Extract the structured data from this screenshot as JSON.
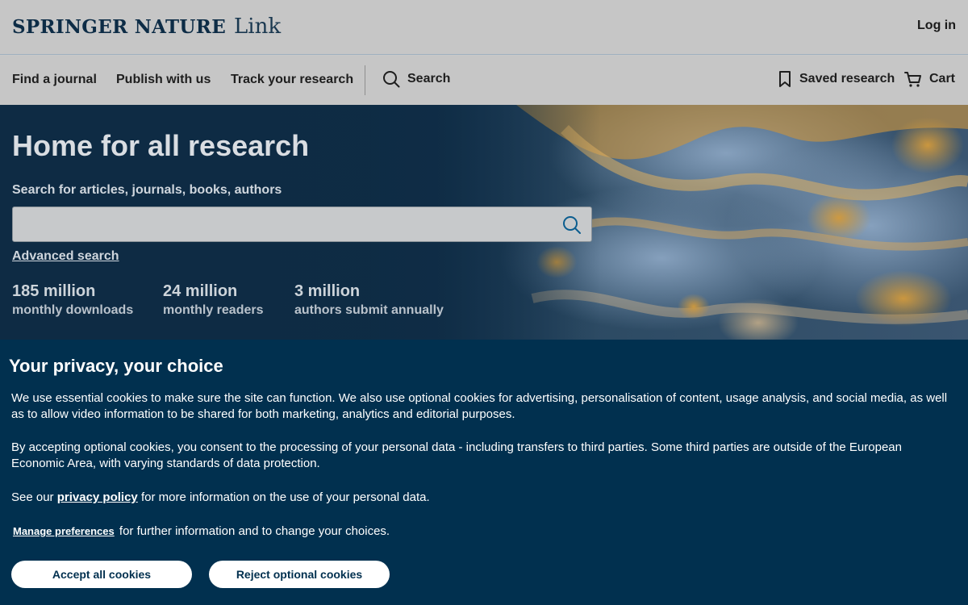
{
  "header": {
    "brand": "SPRINGER NATURE",
    "brand_sub": "Link",
    "login": "Log in"
  },
  "nav": {
    "items": [
      "Find a journal",
      "Publish with us",
      "Track your research"
    ],
    "search": "Search",
    "saved": "Saved research",
    "cart": "Cart"
  },
  "hero": {
    "title": "Home for all research",
    "search_label": "Search for articles, journals, books, authors",
    "search_value": "",
    "advanced": "Advanced search",
    "stats": [
      {
        "value": "185 million",
        "label": "monthly downloads"
      },
      {
        "value": "24 million",
        "label": "monthly readers"
      },
      {
        "value": "3 million",
        "label": "authors submit annually"
      }
    ]
  },
  "cookie": {
    "title": "Your privacy, your choice",
    "p1": "We use essential cookies to make sure the site can function. We also use optional cookies for advertising, personalisation of content, usage analysis, and social media, as well as to allow video information to be shared for both marketing, analytics and editorial purposes.",
    "p2": "By accepting optional cookies, you consent to the processing of your personal data - including transfers to third parties. Some third parties are outside of the European Economic Area, with varying standards of data protection.",
    "p3_pre": "See our",
    "privacy_link": "privacy policy",
    "p3_post": "for more information on the use of your personal data.",
    "manage_link": "Manage preferences",
    "p4_post": "for further information and to change your choices.",
    "accept": "Accept all cookies",
    "reject": "Reject optional cookies"
  },
  "colors": {
    "cookie_bg": "#01304f",
    "brand_navy": "#0d2c46",
    "hero_dark": "#0e2b44"
  }
}
